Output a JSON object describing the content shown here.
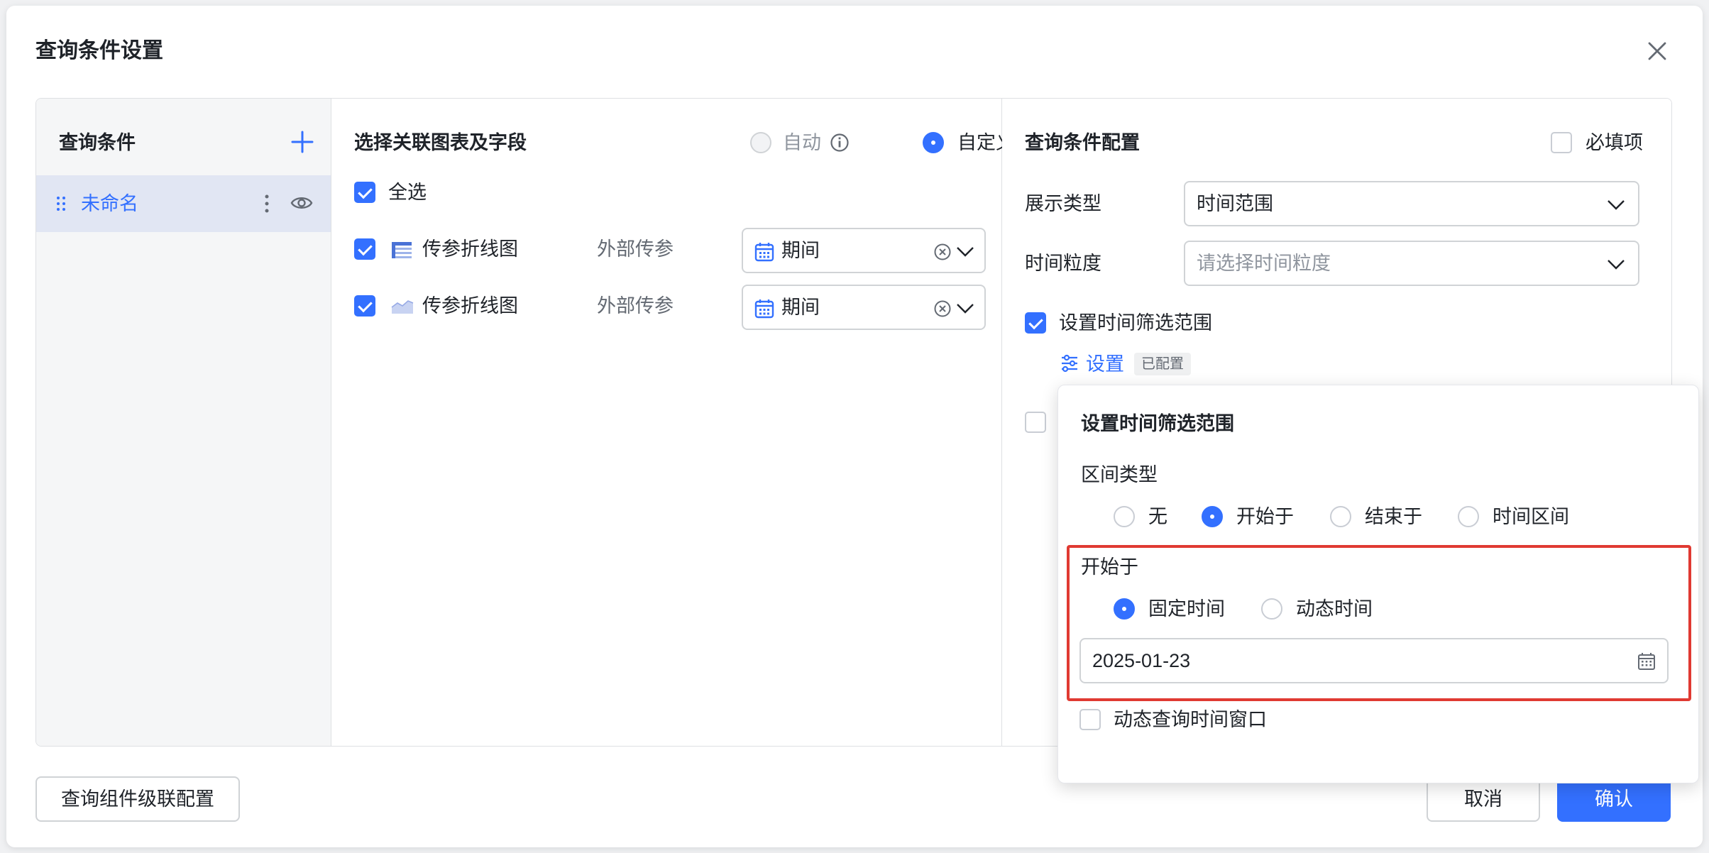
{
  "dialog": {
    "title": "查询条件设置"
  },
  "left": {
    "title": "查询条件",
    "items": [
      {
        "label": "未命名"
      }
    ]
  },
  "middle": {
    "title": "选择关联图表及字段",
    "mode_options": [
      {
        "label": "自动",
        "selected": false,
        "disabled": true
      },
      {
        "label": "自定义",
        "selected": true
      }
    ],
    "select_all_label": "全选",
    "rows": [
      {
        "chart": "传参折线图",
        "type": "外部传参",
        "field": "期间",
        "icon": "table-chart-icon"
      },
      {
        "chart": "传参折线图",
        "type": "外部传参",
        "field": "期间",
        "icon": "area-chart-icon"
      }
    ]
  },
  "right": {
    "title": "查询条件配置",
    "required_label": "必填项",
    "display_type_label": "展示类型",
    "display_type_value": "时间范围",
    "granularity_label": "时间粒度",
    "granularity_placeholder": "请选择时间粒度",
    "filter_range_label": "设置时间筛选范围",
    "settings_link": "设置",
    "configured_badge": "已配置"
  },
  "popover": {
    "title": "设置时间筛选范围",
    "interval_label": "区间类型",
    "interval_options": [
      "无",
      "开始于",
      "结束于",
      "时间区间"
    ],
    "interval_selected": "开始于",
    "start_label": "开始于",
    "time_modes": [
      "固定时间",
      "动态时间"
    ],
    "time_mode_selected": "固定时间",
    "date_value": "2025-01-23",
    "dynamic_window_label": "动态查询时间窗口"
  },
  "footer": {
    "cascade_button": "查询组件级联配置",
    "cancel_button": "取消",
    "confirm_button": "确认"
  },
  "colors": {
    "accent": "#3370ff",
    "highlight": "#e03a32"
  }
}
